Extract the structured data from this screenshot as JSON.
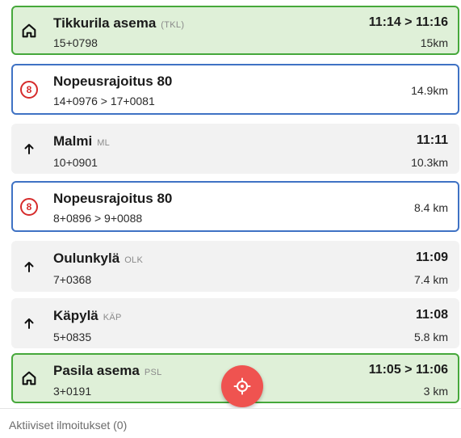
{
  "items": [
    {
      "kind": "station",
      "name": "Tikkurila asema",
      "code": "(TKL)",
      "km": "15+0798",
      "time": "11:14 > 11:16",
      "distance": "15km",
      "icon": "home-icon"
    },
    {
      "kind": "limit",
      "name": "Nopeusrajoitus 80",
      "badge": "8",
      "km": "14+0976 > 17+0081",
      "distance": "14.9km",
      "icon": "speed-limit-icon"
    },
    {
      "kind": "stop",
      "name": "Malmi",
      "code": "ML",
      "km": "10+0901",
      "time": "11:11",
      "distance": "10.3km",
      "icon": "arrow-up-icon"
    },
    {
      "kind": "limit",
      "name": "Nopeusrajoitus 80",
      "badge": "8",
      "km": "8+0896 > 9+0088",
      "distance": "8.4 km",
      "icon": "speed-limit-icon"
    },
    {
      "kind": "stop",
      "name": "Oulunkylä",
      "code": "OLK",
      "km": "7+0368",
      "time": "11:09",
      "distance": "7.4 km",
      "icon": "arrow-up-icon"
    },
    {
      "kind": "stop",
      "name": "Käpylä",
      "code": "KÄP",
      "km": "5+0835",
      "time": "11:08",
      "distance": "5.8 km",
      "icon": "arrow-up-icon"
    },
    {
      "kind": "station",
      "name": "Pasila asema",
      "code": "PSL",
      "km": "3+0191",
      "time": "11:05 > 11:06",
      "distance": "3 km",
      "icon": "home-icon"
    }
  ],
  "fab": {
    "icon": "locate-icon"
  },
  "footer": {
    "label": "Aktiiviset ilmoitukset (0)"
  },
  "colors": {
    "station_bg": "#dff0d8",
    "station_border": "#46a83b",
    "limit_border": "#3f72c4",
    "limit_badge": "#d62b2b",
    "fab": "#ef5350"
  }
}
